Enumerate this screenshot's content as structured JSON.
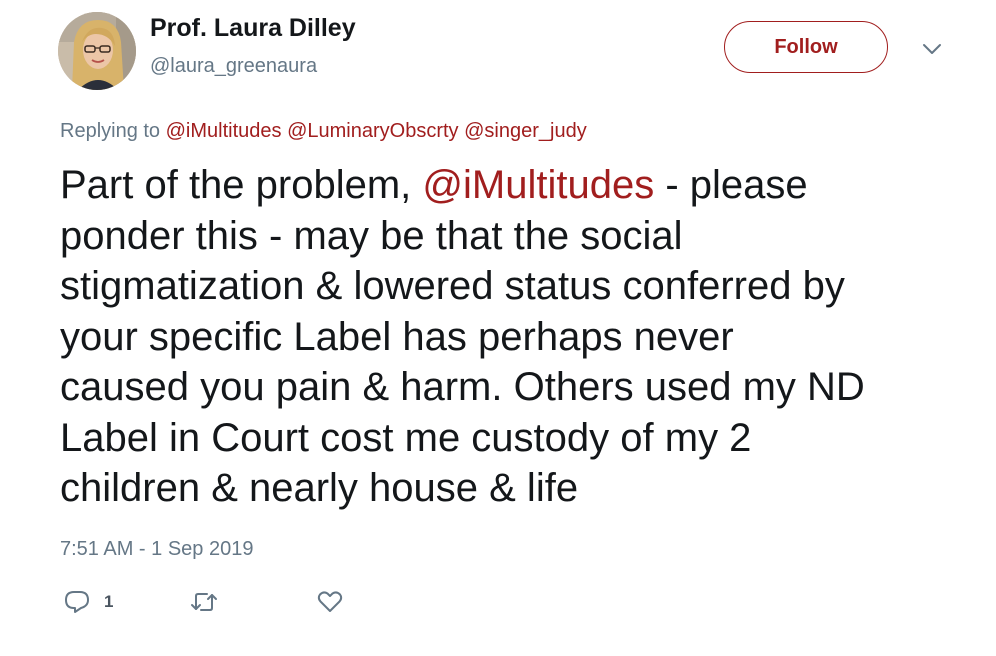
{
  "author": {
    "name": "Prof. Laura Dilley",
    "handle": "@laura_greenaura",
    "avatar_icon": "profile-photo"
  },
  "follow_button": {
    "label": "Follow"
  },
  "menu_icon": "chevron-down-icon",
  "replying": {
    "prefix": "Replying to",
    "mentions": [
      "@iMultitudes",
      "@LuminaryObscrty",
      "@singer_judy"
    ]
  },
  "body": {
    "line1_before": "Part of the problem, ",
    "line1_mention": "@iMultitudes",
    "line1_after": " - please",
    "line2": "ponder this - may be that the social",
    "line3": "stigmatization & lowered status conferred by",
    "line4": "your specific Label has perhaps never",
    "line5": "caused you pain & harm. Others used my ND",
    "line6": "Label in Court cost me custody of my 2",
    "line7": "children & nearly house & life"
  },
  "timestamp": "7:51 AM - 1 Sep 2019",
  "actions": {
    "reply_count": "1",
    "reply_icon": "reply-icon",
    "retweet_icon": "retweet-icon",
    "like_icon": "heart-icon"
  },
  "colors": {
    "accent": "#a11e1e",
    "text": "#14171a",
    "secondary": "#657786"
  }
}
